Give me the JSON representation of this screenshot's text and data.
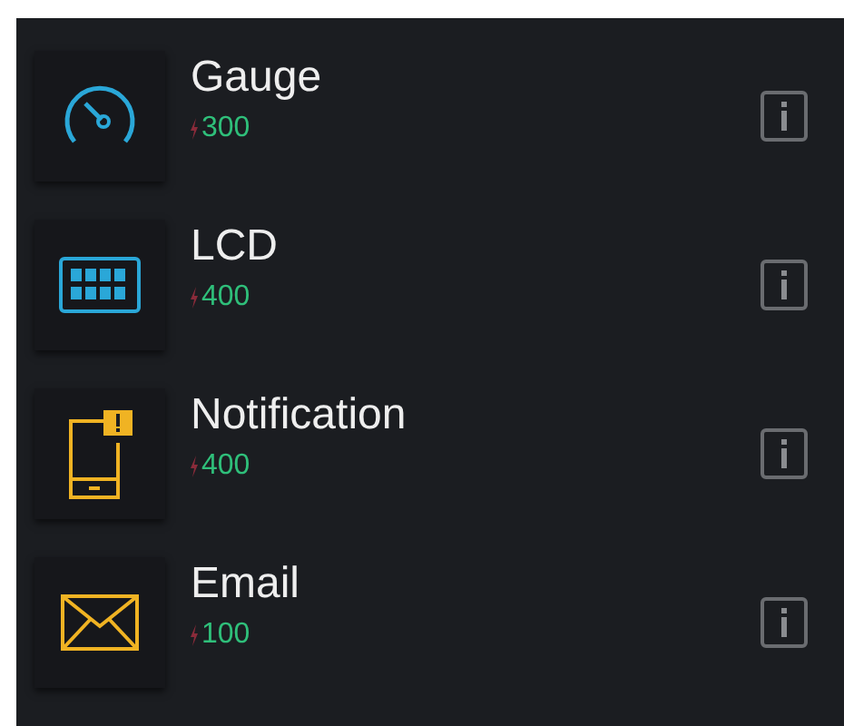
{
  "widgets": [
    {
      "kind": "gauge",
      "name": "Gauge",
      "price": "300"
    },
    {
      "kind": "lcd",
      "name": "LCD",
      "price": "400"
    },
    {
      "kind": "notification",
      "name": "Notification",
      "price": "400"
    },
    {
      "kind": "email",
      "name": "Email",
      "price": "100"
    }
  ]
}
